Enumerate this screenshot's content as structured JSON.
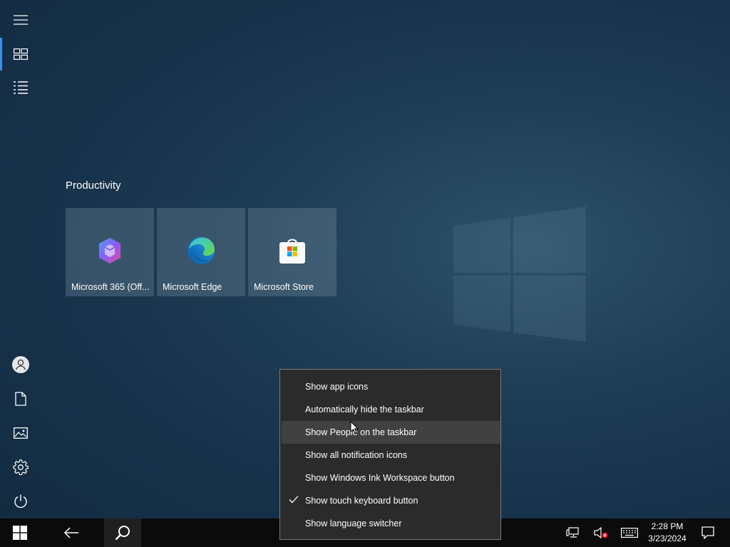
{
  "start": {
    "group_title": "Productivity",
    "tiles": [
      {
        "label": "Microsoft 365 (Off...",
        "icon": "microsoft-365-icon"
      },
      {
        "label": "Microsoft Edge",
        "icon": "edge-icon"
      },
      {
        "label": "Microsoft Store",
        "icon": "store-icon"
      }
    ],
    "rail_icons": [
      "hamburger-menu-icon",
      "tiles-view-icon",
      "list-view-icon",
      "user-icon",
      "documents-icon",
      "pictures-icon",
      "settings-icon",
      "power-icon"
    ]
  },
  "context_menu": {
    "items": [
      {
        "label": "Show app icons",
        "checked": false
      },
      {
        "label": "Automatically hide the taskbar",
        "checked": false
      },
      {
        "label": "Show People on the taskbar",
        "checked": false,
        "hovered": true
      },
      {
        "label": "Show all notification icons",
        "checked": false
      },
      {
        "label": "Show Windows Ink Workspace button",
        "checked": false
      },
      {
        "label": "Show touch keyboard button",
        "checked": true
      },
      {
        "label": "Show language switcher",
        "checked": false
      }
    ]
  },
  "taskbar": {
    "time": "2:28 PM",
    "date": "3/23/2024",
    "icons": [
      "windows-start-icon",
      "back-icon",
      "search-icon",
      "network-icon",
      "volume-muted-icon",
      "touch-keyboard-icon",
      "action-center-icon"
    ]
  },
  "colors": {
    "accent": "#3d8ee8",
    "menu_bg": "#2b2b2b",
    "menu_hover": "#414141",
    "taskbar_bg": "#0b0b0b"
  }
}
